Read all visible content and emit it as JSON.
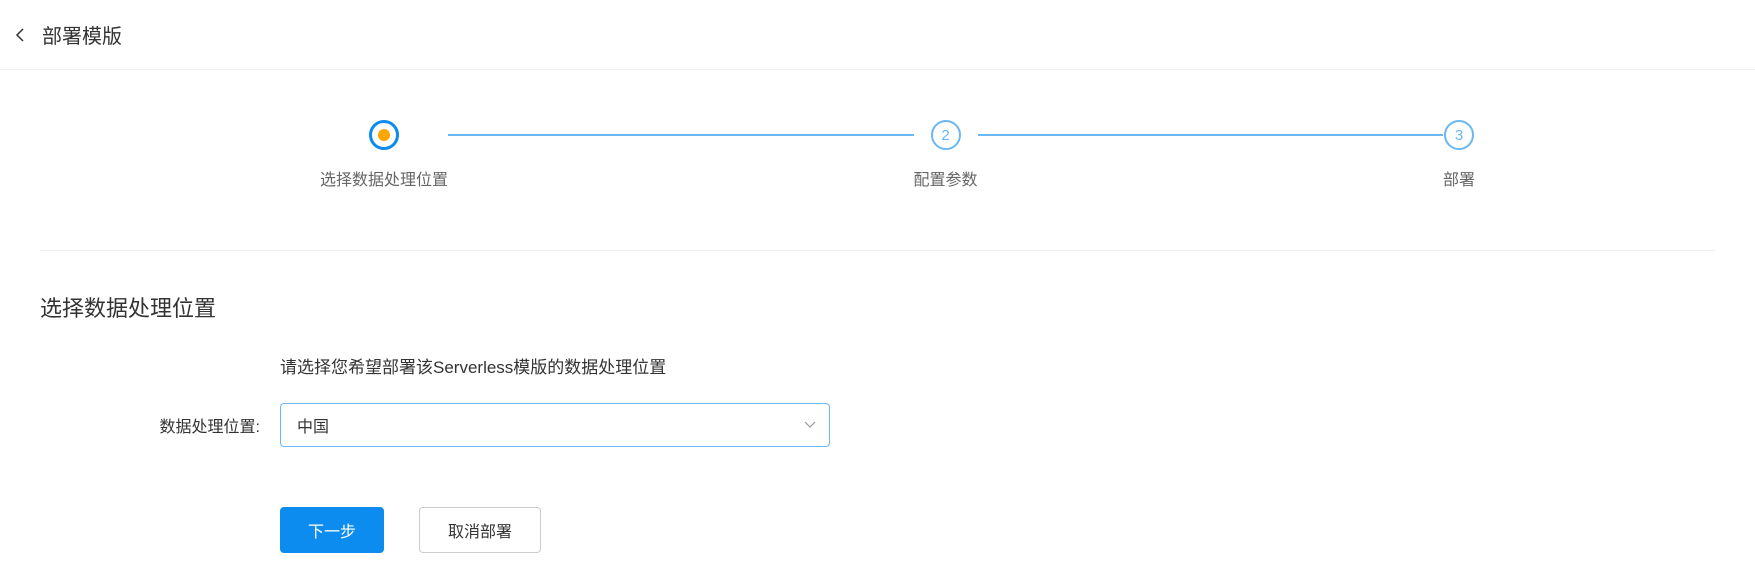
{
  "header": {
    "title": "部署模版"
  },
  "stepper": {
    "steps": [
      {
        "label": "选择数据处理位置",
        "state": "active"
      },
      {
        "number": "2",
        "label": "配置参数",
        "state": "pending"
      },
      {
        "number": "3",
        "label": "部署",
        "state": "pending"
      }
    ]
  },
  "form": {
    "section_title": "选择数据处理位置",
    "section_desc": "请选择您希望部署该Serverless模版的数据处理位置",
    "location_label": "数据处理位置:",
    "location_value": "中国"
  },
  "buttons": {
    "next": "下一步",
    "cancel": "取消部署"
  }
}
